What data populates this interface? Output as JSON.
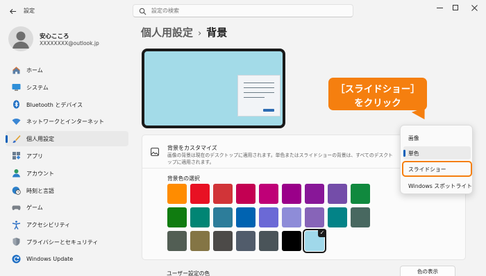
{
  "titlebar": {
    "app_title": "設定",
    "search_placeholder": "設定の検索"
  },
  "profile": {
    "name": "安心こころ",
    "email": "XXXXXXXX@outlook.jp"
  },
  "sidebar": {
    "items": [
      {
        "label": "ホーム",
        "icon": "home-icon"
      },
      {
        "label": "システム",
        "icon": "monitor-icon"
      },
      {
        "label": "Bluetooth とデバイス",
        "icon": "bluetooth-icon"
      },
      {
        "label": "ネットワークとインターネット",
        "icon": "wifi-icon"
      },
      {
        "label": "個人用設定",
        "icon": "brush-icon",
        "active": true
      },
      {
        "label": "アプリ",
        "icon": "apps-icon"
      },
      {
        "label": "アカウント",
        "icon": "account-icon"
      },
      {
        "label": "時刻と言語",
        "icon": "globe-clock-icon"
      },
      {
        "label": "ゲーム",
        "icon": "gamepad-icon"
      },
      {
        "label": "アクセシビリティ",
        "icon": "accessibility-icon"
      },
      {
        "label": "プライバシーとセキュリティ",
        "icon": "shield-icon"
      },
      {
        "label": "Windows Update",
        "icon": "update-icon"
      }
    ]
  },
  "header": {
    "parent": "個人用設定",
    "separator": "›",
    "current": "背景"
  },
  "background": {
    "title": "背景をカスタマイズ",
    "description": "画像の背景は現在のデスクトップに適用されます。単色またはスライドショーの背景は、すべてのデスクトップに適用されます。",
    "colors_label": "背景色の選択",
    "custom_color_label": "ユーザー設定の色",
    "show_color_button": "色の表示",
    "swatches": [
      "#ff8c00",
      "#e81123",
      "#d13438",
      "#c30052",
      "#bf0077",
      "#9a0089",
      "#881798",
      "#744da9",
      "#10893e",
      "#107c10",
      "#018574",
      "#2d7d9a",
      "#0063b1",
      "#6b69d6",
      "#8e8cd8",
      "#8764b8",
      "#038387",
      "#486860",
      "#525e54",
      "#847545",
      "#4c4a48",
      "#515c6b",
      "#4a5459",
      "#000000",
      "#a0d8ea"
    ],
    "selected_swatch": 24,
    "preview_bg": "#a3dbe8"
  },
  "dropdown": {
    "options": [
      "画像",
      "単色",
      "スライドショー",
      "Windows スポットライト"
    ],
    "selected": "単色",
    "highlighted": "スライドショー"
  },
  "callout": {
    "line1": "［スライドショー］",
    "line2": "をクリック",
    "color": "#f57f0f"
  }
}
